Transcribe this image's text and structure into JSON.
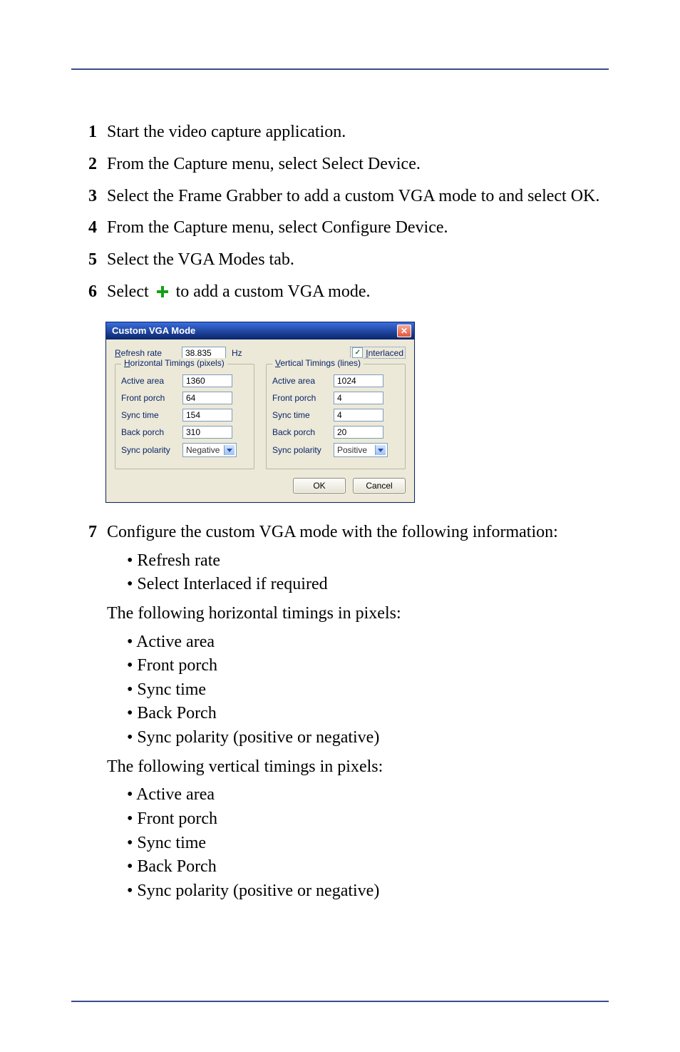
{
  "steps": {
    "s1": "Start the video capture application.",
    "s2": "From the Capture menu, select Select Device.",
    "s3": "Select the Frame Grabber to add a custom VGA mode to and select OK.",
    "s4": "From the Capture menu, select Configure Device.",
    "s5": "Select the VGA Modes tab.",
    "s6_a": "Select",
    "s6_b": "to add a custom VGA mode.",
    "s7_intro": "Configure the custom VGA mode with the following information:",
    "s7_b1": "Refresh rate",
    "s7_b2": "Select Interlaced if required",
    "s7_p1": "The following horizontal timings in pixels:",
    "s7_h1": "Active area",
    "s7_h2": "Front porch",
    "s7_h3": "Sync time",
    "s7_h4": "Back Porch",
    "s7_h5": "Sync polarity (positive or negative)",
    "s7_p2": "The following vertical timings in pixels:",
    "s7_v1": "Active area",
    "s7_v2": "Front porch",
    "s7_v3": "Sync time",
    "s7_v4": "Back Porch",
    "s7_v5": "Sync polarity (positive or negative)"
  },
  "nums": {
    "n1": "1",
    "n2": "2",
    "n3": "3",
    "n4": "4",
    "n5": "5",
    "n6": "6",
    "n7": "7"
  },
  "dialog": {
    "title": "Custom VGA Mode",
    "close_glyph": "✕",
    "refresh_label_pre": "R",
    "refresh_label_rest": "efresh rate",
    "refresh_value": "38.835",
    "hz": "Hz",
    "interlaced_label_pre": "I",
    "interlaced_label_rest": "nterlaced",
    "interlaced_checked": "✓",
    "h_title_pre": "H",
    "h_title_rest": "orizontal Timings (pixels)",
    "v_title_pre": "V",
    "v_title_rest": "ertical Timings (lines)",
    "lbl_active": "Active area",
    "lbl_front": "Front porch",
    "lbl_sync": "Sync time",
    "lbl_back": "Back porch",
    "lbl_pol": "Sync polarity",
    "h_active": "1360",
    "h_front": "64",
    "h_sync": "154",
    "h_back": "310",
    "h_pol": "Negative",
    "v_active": "1024",
    "v_front": "4",
    "v_sync": "4",
    "v_back": "20",
    "v_pol": "Positive",
    "ok": "OK",
    "cancel": "Cancel"
  }
}
